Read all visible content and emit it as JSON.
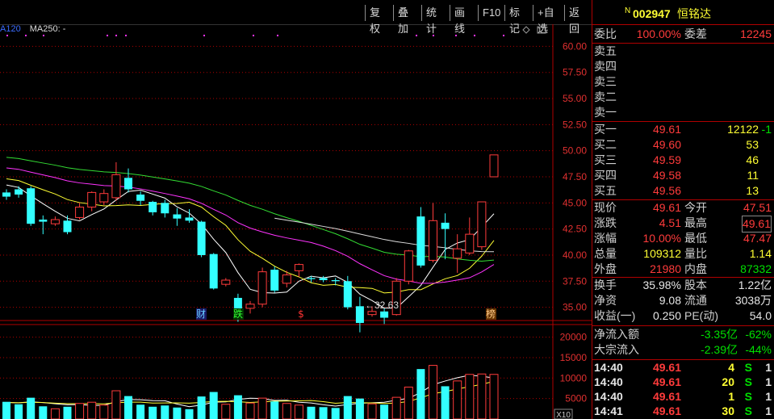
{
  "toolbar": {
    "buttons": [
      "复权",
      "叠加",
      "统计",
      "画线",
      "F10",
      "标记",
      "+自选",
      "返回"
    ]
  },
  "ma_legend": {
    "partial": "A120",
    "ma250": "MA250: -"
  },
  "price_axis": [
    "60.00",
    "57.50",
    "55.00",
    "52.50",
    "50.00",
    "47.50",
    "45.00",
    "42.50",
    "40.00",
    "37.50",
    "35.00"
  ],
  "volume_axis": [
    "20000",
    "15000",
    "10000",
    "5000"
  ],
  "volume_unit": "X10",
  "markers": {
    "cai": "财",
    "die": "跌",
    "s": "$",
    "bang": "榜",
    "low_label": "←32.63"
  },
  "stock": {
    "flag": "N",
    "code": "002947",
    "name": "恒铭达"
  },
  "weibi": {
    "label": "委比",
    "value": "100.00%",
    "label2": "委差",
    "value2": "12245"
  },
  "sells": [
    "卖五",
    "卖四",
    "卖三",
    "卖二",
    "卖一"
  ],
  "buys": [
    {
      "label": "买一",
      "price": "49.61",
      "vol": "12122",
      "chg": "-1"
    },
    {
      "label": "买二",
      "price": "49.60",
      "vol": "53",
      "chg": ""
    },
    {
      "label": "买三",
      "price": "49.59",
      "vol": "46",
      "chg": ""
    },
    {
      "label": "买四",
      "price": "49.58",
      "vol": "11",
      "chg": ""
    },
    {
      "label": "买五",
      "price": "49.56",
      "vol": "13",
      "chg": ""
    }
  ],
  "quote": [
    {
      "l1": "现价",
      "v1": "49.61",
      "l2": "今开",
      "v2": "47.51"
    },
    {
      "l1": "涨跌",
      "v1": "4.51",
      "l2": "最高",
      "v2": "49.61"
    },
    {
      "l1": "涨幅",
      "v1": "10.00%",
      "l2": "最低",
      "v2": "47.47"
    },
    {
      "l1": "总量",
      "v1": "109312",
      "l2": "量比",
      "v2": "1.14"
    },
    {
      "l1": "外盘",
      "v1": "21980",
      "l2": "内盘",
      "v2": "87332"
    }
  ],
  "stats": [
    {
      "l1": "换手",
      "v1": "35.98%",
      "l2": "股本",
      "v2": "1.22亿"
    },
    {
      "l1": "净资",
      "v1": "9.08",
      "l2": "流通",
      "v2": "3038万"
    },
    {
      "l1": "收益(一)",
      "v1": "0.250",
      "l2": "PE(动)",
      "v2": "54.0"
    }
  ],
  "flows": [
    {
      "label": "净流入额",
      "value": "-3.35亿",
      "pct": "-62%"
    },
    {
      "label": "大宗流入",
      "value": "-2.39亿",
      "pct": "-44%"
    }
  ],
  "ticks": [
    {
      "time": "14:40",
      "price": "49.61",
      "vol": "4",
      "side": "S",
      "n": "1"
    },
    {
      "time": "14:40",
      "price": "49.61",
      "vol": "20",
      "side": "S",
      "n": "1"
    },
    {
      "time": "14:40",
      "price": "49.61",
      "vol": "1",
      "side": "S",
      "n": "1"
    },
    {
      "time": "14:41",
      "price": "49.61",
      "vol": "30",
      "side": "S",
      "n": "1"
    }
  ],
  "chart_data": {
    "type": "candlestick",
    "price_range": [
      33.5,
      61.5
    ],
    "volume_range": [
      0,
      21500
    ],
    "candles": [
      {
        "o": 46.0,
        "c": 45.6,
        "h": 46.3,
        "l": 45.3,
        "v": 4200
      },
      {
        "o": 46.3,
        "c": 45.8,
        "h": 46.6,
        "l": 45.5,
        "v": 3600
      },
      {
        "o": 46.4,
        "c": 43.0,
        "h": 46.6,
        "l": 42.8,
        "v": 5200
      },
      {
        "o": 43.4,
        "c": 43.2,
        "h": 43.8,
        "l": 42.0,
        "v": 3100
      },
      {
        "o": 43.0,
        "c": 43.4,
        "h": 43.7,
        "l": 42.8,
        "v": 2500
      },
      {
        "o": 43.3,
        "c": 42.2,
        "h": 43.8,
        "l": 42.0,
        "v": 3000
      },
      {
        "o": 43.6,
        "c": 44.6,
        "h": 45.0,
        "l": 43.4,
        "v": 3800
      },
      {
        "o": 44.6,
        "c": 46.0,
        "h": 46.1,
        "l": 44.2,
        "v": 4100
      },
      {
        "o": 45.1,
        "c": 45.9,
        "h": 46.3,
        "l": 44.8,
        "v": 3400
      },
      {
        "o": 45.5,
        "c": 47.7,
        "h": 48.9,
        "l": 45.2,
        "v": 6900
      },
      {
        "o": 47.4,
        "c": 46.3,
        "h": 48.3,
        "l": 46.0,
        "v": 5600
      },
      {
        "o": 45.8,
        "c": 45.2,
        "h": 46.1,
        "l": 44.8,
        "v": 3500
      },
      {
        "o": 45.1,
        "c": 44.1,
        "h": 45.2,
        "l": 43.8,
        "v": 3000
      },
      {
        "o": 45.0,
        "c": 44.0,
        "h": 45.3,
        "l": 43.6,
        "v": 3300
      },
      {
        "o": 43.9,
        "c": 43.5,
        "h": 44.5,
        "l": 42.8,
        "v": 2800
      },
      {
        "o": 43.6,
        "c": 43.3,
        "h": 44.4,
        "l": 43.1,
        "v": 2400
      },
      {
        "o": 43.2,
        "c": 40.0,
        "h": 43.3,
        "l": 39.8,
        "v": 5500
      },
      {
        "o": 40.1,
        "c": 36.8,
        "h": 40.2,
        "l": 36.7,
        "v": 6600
      },
      {
        "o": 37.2,
        "c": 37.6,
        "h": 37.8,
        "l": 37.0,
        "v": 3600
      },
      {
        "o": 35.9,
        "c": 33.9,
        "h": 36.3,
        "l": 33.6,
        "v": 5800
      },
      {
        "o": 34.9,
        "c": 35.3,
        "h": 35.6,
        "l": 34.4,
        "v": 3900
      },
      {
        "o": 35.3,
        "c": 38.4,
        "h": 38.8,
        "l": 35.0,
        "v": 5100
      },
      {
        "o": 38.6,
        "c": 36.6,
        "h": 38.9,
        "l": 36.4,
        "v": 4300
      },
      {
        "o": 37.3,
        "c": 38.1,
        "h": 38.5,
        "l": 36.9,
        "v": 3800
      },
      {
        "o": 38.5,
        "c": 39.1,
        "h": 39.2,
        "l": 37.9,
        "v": 3400
      },
      {
        "o": 37.8,
        "c": 37.7,
        "h": 38.0,
        "l": 37.4,
        "v": 3000
      },
      {
        "o": 37.8,
        "c": 37.6,
        "h": 38.0,
        "l": 37.4,
        "v": 2900
      },
      {
        "o": 37.6,
        "c": 37.5,
        "h": 37.8,
        "l": 37.1,
        "v": 2700
      },
      {
        "o": 37.5,
        "c": 35.0,
        "h": 38.0,
        "l": 34.8,
        "v": 5600
      },
      {
        "o": 35.1,
        "c": 33.5,
        "h": 36.0,
        "l": 32.6,
        "v": 5000
      },
      {
        "o": 34.3,
        "c": 34.6,
        "h": 35.1,
        "l": 34.1,
        "v": 3700
      },
      {
        "o": 34.6,
        "c": 34.0,
        "h": 34.9,
        "l": 33.4,
        "v": 3500
      },
      {
        "o": 34.3,
        "c": 37.5,
        "h": 37.8,
        "l": 34.2,
        "v": 5300
      },
      {
        "o": 37.5,
        "c": 40.4,
        "h": 40.5,
        "l": 37.2,
        "v": 7800
      },
      {
        "o": 43.7,
        "c": 39.0,
        "h": 44.6,
        "l": 38.8,
        "v": 12200
      },
      {
        "o": 39.5,
        "c": 43.3,
        "h": 45.0,
        "l": 39.3,
        "v": 13100
      },
      {
        "o": 43.1,
        "c": 42.5,
        "h": 44.0,
        "l": 39.6,
        "v": 8000
      },
      {
        "o": 39.7,
        "c": 40.6,
        "h": 42.0,
        "l": 38.3,
        "v": 9300
      },
      {
        "o": 40.2,
        "c": 42.0,
        "h": 43.6,
        "l": 40.0,
        "v": 10900
      },
      {
        "o": 40.8,
        "c": 45.1,
        "h": 45.1,
        "l": 40.5,
        "v": 11000
      },
      {
        "o": 47.5,
        "c": 49.6,
        "h": 49.6,
        "l": 47.5,
        "v": 10900
      }
    ]
  }
}
